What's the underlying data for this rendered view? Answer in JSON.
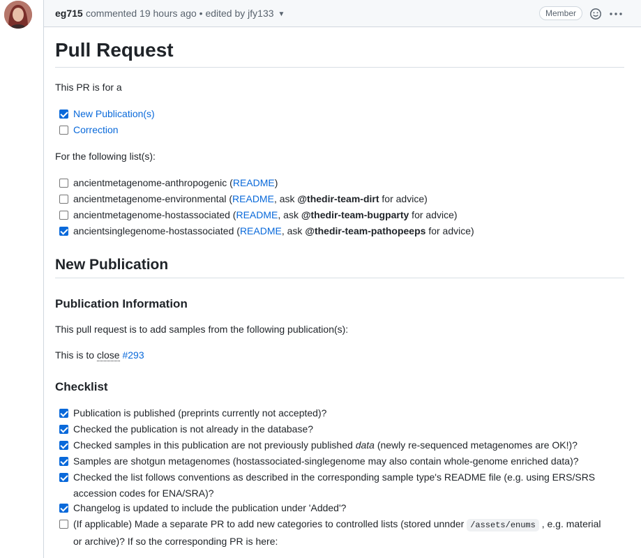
{
  "comment": {
    "author": "eg715",
    "meta_text": "commented 19 hours ago • edited by jfy133",
    "badge": "Member"
  },
  "body": {
    "title": "Pull Request",
    "intro": "This PR is for a",
    "pr_type": [
      {
        "label": "New Publication(s)",
        "checked": true
      },
      {
        "label": "Correction",
        "checked": false
      }
    ],
    "lists_intro": "For the following list(s):",
    "lists": [
      {
        "name": "ancientmetagenome-anthropogenic",
        "readme": "README",
        "ask": "",
        "team": "",
        "suffix": "",
        "checked": false
      },
      {
        "name": "ancientmetagenome-environmental",
        "readme": "README",
        "ask": ", ask ",
        "team": "@thedir-team-dirt",
        "suffix": " for advice)",
        "checked": false
      },
      {
        "name": "ancientmetagenome-hostassociated",
        "readme": "README",
        "ask": ", ask ",
        "team": "@thedir-team-bugparty",
        "suffix": " for advice)",
        "checked": false
      },
      {
        "name": "ancientsinglegenome-hostassociated",
        "readme": "README",
        "ask": ", ask ",
        "team": "@thedir-team-pathopeeps",
        "suffix": " for advice)",
        "checked": true
      }
    ],
    "new_pub_title": "New Publication",
    "pub_info_title": "Publication Information",
    "pub_info_text": "This pull request is to add samples from the following publication(s):",
    "close_prefix": "This is to ",
    "close_word": "close",
    "close_issue": "#293",
    "checklist_title": "Checklist",
    "checklist": [
      {
        "text": "Publication is published (preprints currently not accepted)?",
        "checked": true
      },
      {
        "text": "Checked the publication is not already in the database?",
        "checked": true
      },
      {
        "text_a": "Checked samples in this publication are not previously published ",
        "text_em": "data",
        "text_b": " (newly re-sequenced metagenomes are OK!)?",
        "checked": true
      },
      {
        "text": "Samples are shotgun metagenomes (hostassociated-singlegenome may also contain whole-genome enriched data)?",
        "checked": true
      },
      {
        "text": "Checked the list follows conventions as described in the corresponding sample type's README file (e.g. using ERS/SRS accession codes for ENA/SRA)?",
        "checked": true
      },
      {
        "text": "Changelog is updated to include the publication under 'Added'?",
        "checked": true
      },
      {
        "text_a": "(If applicable) Made a separate PR to add new categories to controlled lists (stored unnder ",
        "code": "/assets/enums",
        "text_b": " , e.g. material or archive)? If so the corresponding PR is here:",
        "checked": false
      }
    ]
  },
  "colors": {
    "link": "#0969da",
    "checkbox": "#0969da",
    "border": "#d0d7de"
  },
  "icons": [
    "smiley-icon",
    "kebab-horizontal-icon"
  ]
}
